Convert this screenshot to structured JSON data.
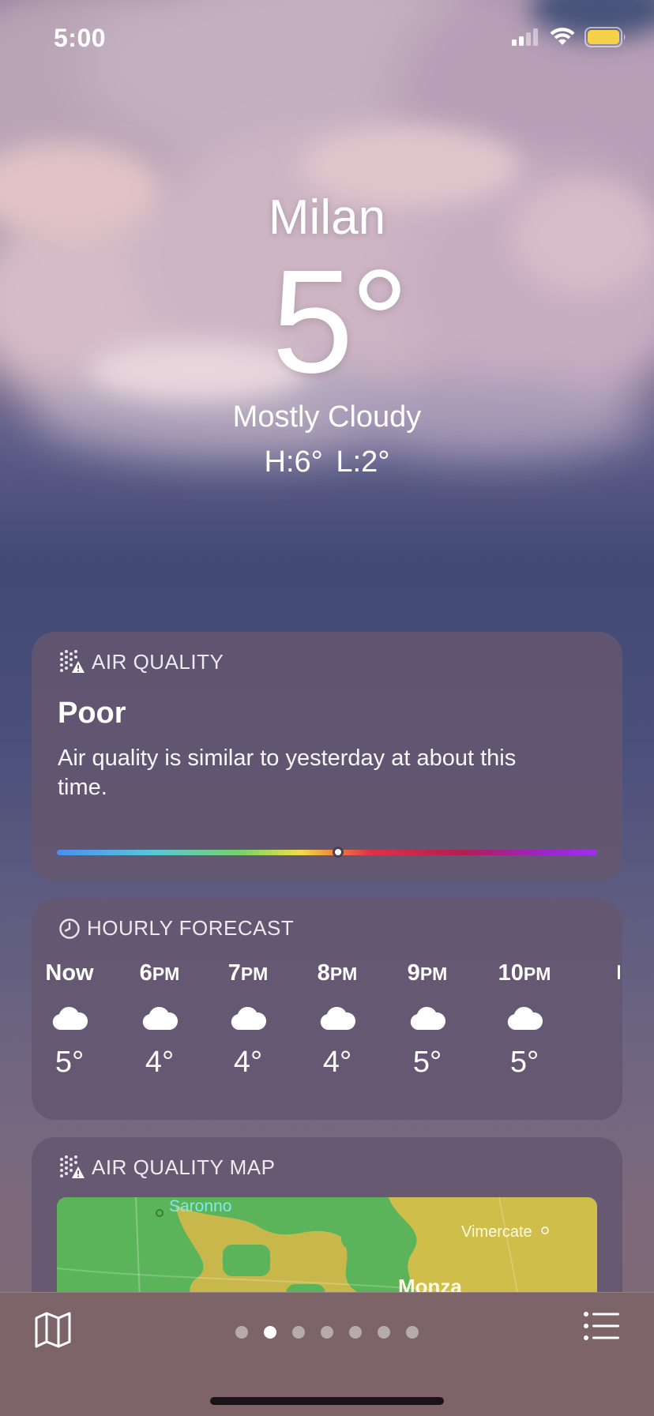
{
  "status_bar": {
    "time": "5:00",
    "icons": [
      "signal-icon",
      "wifi-icon",
      "battery-icon"
    ],
    "battery_color": "#f6d24a"
  },
  "location": {
    "city": "Milan",
    "temperature": "5°",
    "condition": "Mostly Cloudy",
    "high_low": "H:6°  L:2°"
  },
  "air_quality": {
    "header": "AIR QUALITY",
    "level": "Poor",
    "description": "Air quality is similar to yesterday at about this time.",
    "indicator_fraction": 0.52
  },
  "hourly": {
    "header": "HOURLY FORECAST",
    "items": [
      {
        "time": "Now",
        "suffix": "",
        "icon": "cloud-icon",
        "temp": "5°"
      },
      {
        "time": "6",
        "suffix": "PM",
        "icon": "cloud-icon",
        "temp": "4°"
      },
      {
        "time": "7",
        "suffix": "PM",
        "icon": "cloud-icon",
        "temp": "4°"
      },
      {
        "time": "8",
        "suffix": "PM",
        "icon": "cloud-icon",
        "temp": "4°"
      },
      {
        "time": "9",
        "suffix": "PM",
        "icon": "cloud-icon",
        "temp": "5°"
      },
      {
        "time": "10",
        "suffix": "PM",
        "icon": "cloud-icon",
        "temp": "5°"
      }
    ]
  },
  "air_quality_map": {
    "header": "AIR QUALITY MAP",
    "places": [
      "Saronno",
      "Vimercate",
      "Monza"
    ]
  },
  "tab_bar": {
    "page_count": 7,
    "active_page": 1,
    "icons": [
      "map-icon",
      "list-icon"
    ]
  }
}
